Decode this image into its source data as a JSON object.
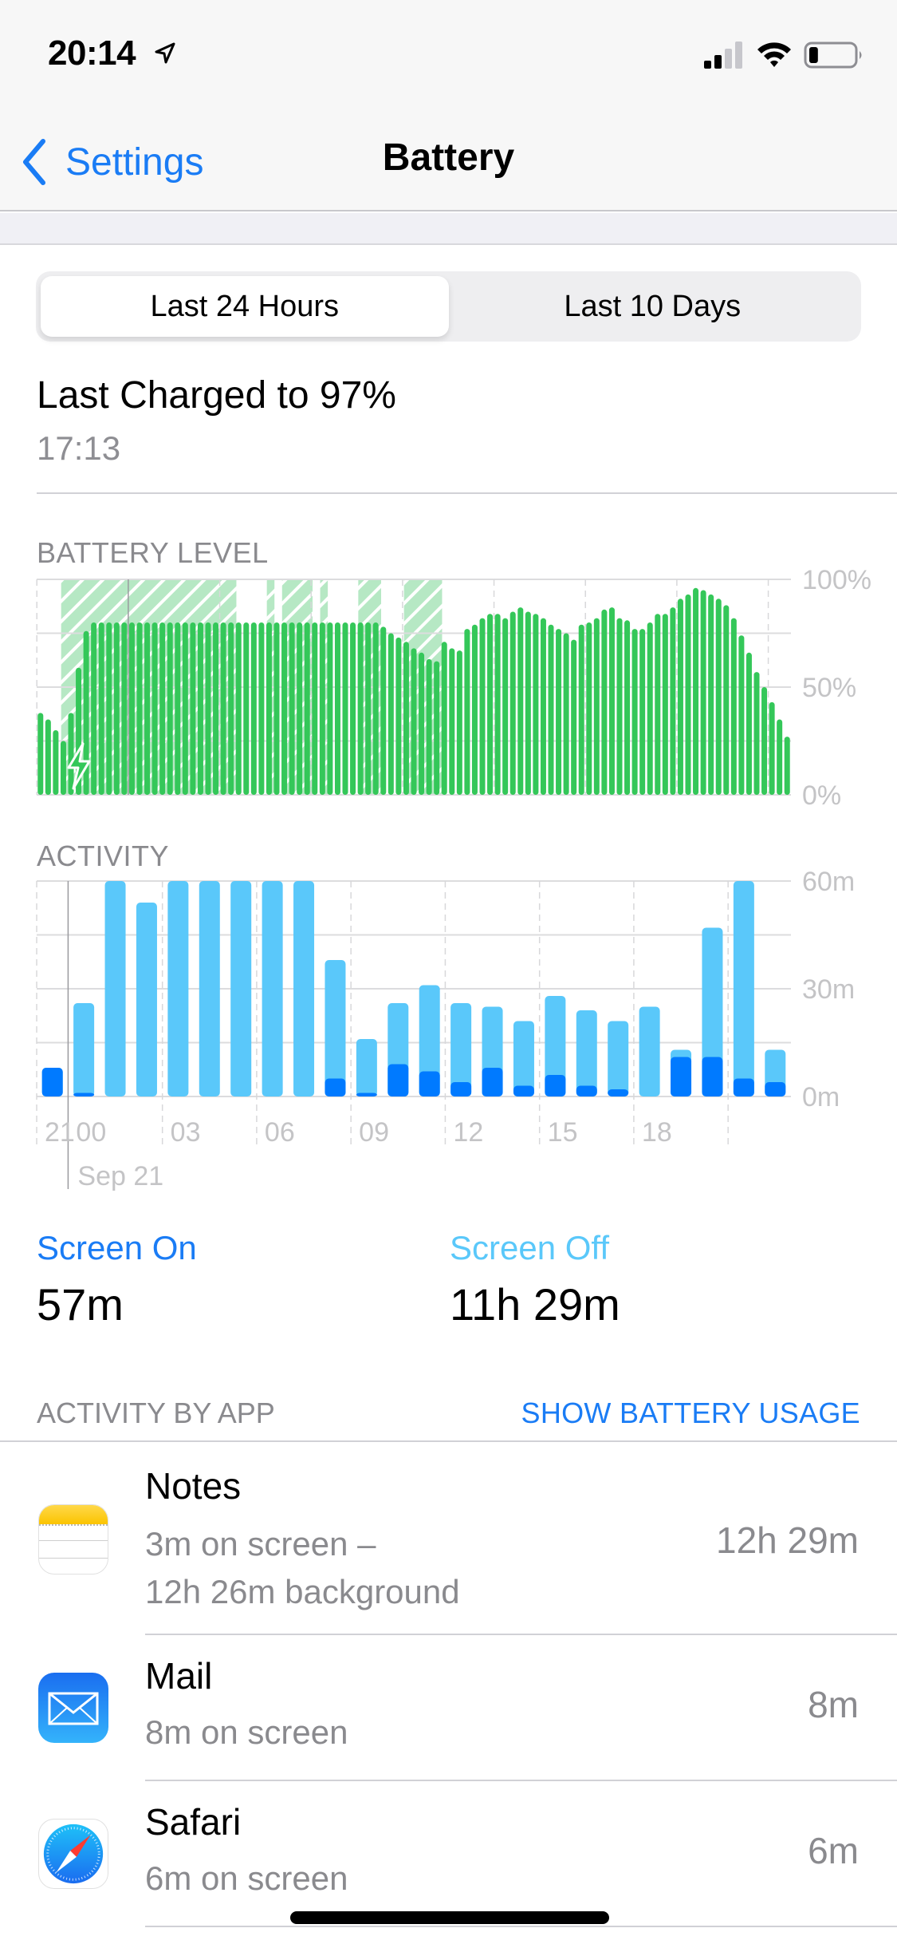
{
  "status_bar": {
    "time": "20:14",
    "location_icon": "location-arrow-icon",
    "signal_icon": "cellular-signal-icon",
    "signal_bars": 2,
    "signal_bars_total": 4,
    "wifi_icon": "wifi-icon",
    "battery_icon": "battery-icon",
    "battery_level_fraction": 0.2
  },
  "nav": {
    "back_label": "Settings",
    "back_icon": "chevron-left-icon",
    "title": "Battery"
  },
  "segmented": {
    "options": [
      "Last 24 Hours",
      "Last 10 Days"
    ],
    "selected": "Last 24 Hours"
  },
  "last_charged": {
    "title": "Last Charged to 97%",
    "time": "17:13"
  },
  "colors": {
    "accent": "#1a7cf5",
    "battery_green": "#34c759",
    "charging_hatch": "#b6e8c4",
    "screen_on": "#007aff",
    "screen_off": "#5ac8fa",
    "secondary_text": "#8a8a8e",
    "axis_text": "#c4c4c6"
  },
  "chart_data": [
    {
      "type": "bar",
      "title": "BATTERY LEVEL",
      "xlabel": "",
      "ylabel": "",
      "ylim": [
        0,
        100
      ],
      "y_ticks": [
        "100%",
        "50%",
        "0%"
      ],
      "y_tick_values": [
        100,
        50,
        0
      ],
      "interval_minutes": 15,
      "grid": true,
      "charging_icon": "charging-bolt-icon",
      "values": [
        38,
        35,
        30,
        25,
        38,
        59,
        76,
        80,
        80,
        80,
        80,
        80,
        80,
        80,
        80,
        80,
        80,
        80,
        80,
        80,
        80,
        80,
        80,
        80,
        80,
        80,
        80,
        80,
        80,
        80,
        80,
        80,
        80,
        80,
        80,
        80,
        80,
        80,
        80,
        80,
        80,
        80,
        80,
        80,
        80,
        78,
        75,
        73,
        71,
        68,
        66,
        63,
        62,
        71,
        68,
        67,
        77,
        79,
        82,
        84,
        84,
        82,
        85,
        87,
        85,
        84,
        82,
        79,
        77,
        75,
        72,
        79,
        80,
        82,
        86,
        87,
        82,
        81,
        77,
        77,
        80,
        84,
        84,
        87,
        91,
        93,
        96,
        95,
        93,
        91,
        88,
        82,
        74,
        66,
        57,
        50,
        43,
        35,
        27
      ],
      "charging_periods": [
        [
          3,
          25
        ],
        [
          30,
          30
        ],
        [
          32,
          35
        ],
        [
          37,
          37
        ],
        [
          42,
          44
        ],
        [
          48,
          52
        ]
      ]
    },
    {
      "type": "bar",
      "title": "ACTIVITY",
      "xlabel": "",
      "ylabel": "",
      "ylim": [
        0,
        60
      ],
      "y_ticks": [
        "60m",
        "30m",
        "0m"
      ],
      "y_tick_values": [
        60,
        30,
        0
      ],
      "grid": true,
      "categories": [
        "20",
        "21",
        "22",
        "23",
        "00",
        "01",
        "02",
        "03",
        "04",
        "05",
        "06",
        "07",
        "08",
        "09",
        "10",
        "11",
        "12",
        "13",
        "14",
        "15",
        "16",
        "17",
        "18",
        "19"
      ],
      "x_tick_labels": [
        "21",
        "00",
        "03",
        "06",
        "09",
        "12",
        "15",
        "18"
      ],
      "date_label": "Sep 21",
      "series": [
        {
          "name": "Screen On",
          "color": "#007aff",
          "values": [
            8,
            1,
            0,
            0,
            0,
            0,
            0,
            0,
            0,
            5,
            1,
            9,
            7,
            4,
            8,
            3,
            6,
            3,
            2,
            0,
            11,
            11,
            5,
            4
          ]
        },
        {
          "name": "Screen Off",
          "color": "#5ac8fa",
          "values": [
            0,
            25,
            60,
            54,
            60,
            60,
            60,
            60,
            60,
            33,
            15,
            17,
            24,
            22,
            17,
            18,
            22,
            21,
            19,
            25,
            2,
            36,
            55,
            9
          ]
        }
      ]
    }
  ],
  "summary": {
    "screen_on_label": "Screen On",
    "screen_on_value": "57m",
    "screen_off_label": "Screen Off",
    "screen_off_value": "11h 29m"
  },
  "activity_by_app": {
    "header": "ACTIVITY BY APP",
    "toggle_label": "SHOW BATTERY USAGE",
    "apps": [
      {
        "name": "Notes",
        "icon": "notes-app-icon",
        "detail_line1": "3m on screen –",
        "detail_line2": "12h 26m background",
        "time": "12h 29m"
      },
      {
        "name": "Mail",
        "icon": "mail-app-icon",
        "detail_line1": "8m on screen",
        "detail_line2": "",
        "time": "8m"
      },
      {
        "name": "Safari",
        "icon": "safari-app-icon",
        "detail_line1": "6m on screen",
        "detail_line2": "",
        "time": "6m"
      }
    ]
  }
}
